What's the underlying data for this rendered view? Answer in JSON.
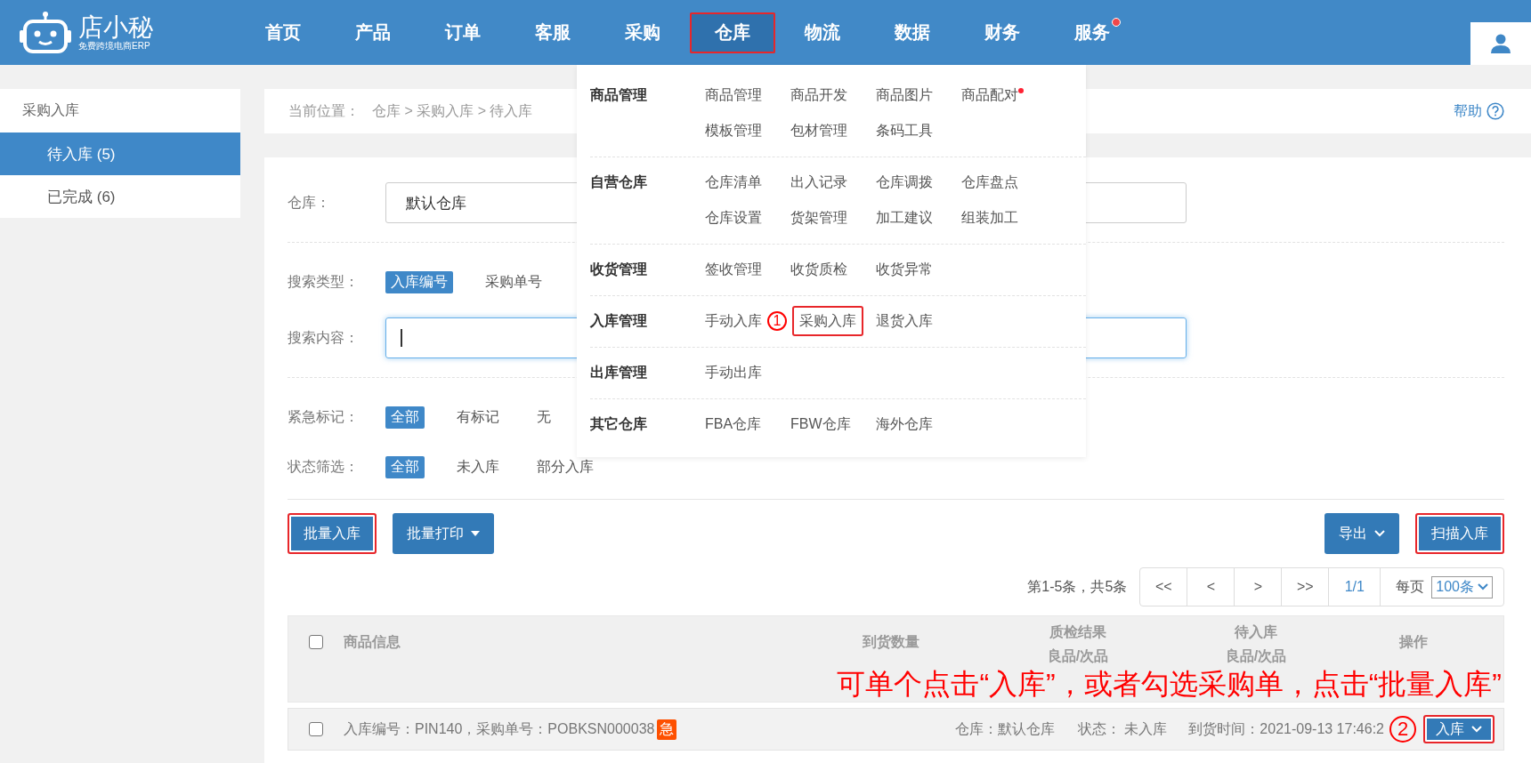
{
  "logo": {
    "name": "店小秘",
    "tagline": "免费跨境电商ERP"
  },
  "nav": [
    {
      "label": "首页",
      "selected": false,
      "dot": false,
      "annotated": false
    },
    {
      "label": "产品",
      "selected": false,
      "dot": false,
      "annotated": false
    },
    {
      "label": "订单",
      "selected": false,
      "dot": false,
      "annotated": false
    },
    {
      "label": "客服",
      "selected": false,
      "dot": false,
      "annotated": false
    },
    {
      "label": "采购",
      "selected": false,
      "dot": false,
      "annotated": false
    },
    {
      "label": "仓库",
      "selected": true,
      "dot": false,
      "annotated": true
    },
    {
      "label": "物流",
      "selected": false,
      "dot": false,
      "annotated": false
    },
    {
      "label": "数据",
      "selected": false,
      "dot": false,
      "annotated": false
    },
    {
      "label": "财务",
      "selected": false,
      "dot": false,
      "annotated": false
    },
    {
      "label": "服务",
      "selected": false,
      "dot": true,
      "annotated": false
    }
  ],
  "sidebar": {
    "title": "采购入库",
    "items": [
      {
        "label": "待入库 (5)",
        "selected": true
      },
      {
        "label": "已完成 (6)",
        "selected": false
      }
    ]
  },
  "breadcrumb": {
    "label": "当前位置：",
    "path": "仓库 > 采购入库 > 待入库",
    "help": "帮助"
  },
  "filter_groups": [
    [
      {
        "kind": "select",
        "label": "仓库：",
        "value": "默认仓库"
      }
    ],
    [
      {
        "kind": "options",
        "label": "搜索类型：",
        "options": [
          {
            "label": "入库编号",
            "selected": true
          },
          {
            "label": "采购单号",
            "selected": false
          }
        ]
      },
      {
        "kind": "input",
        "label": "搜索内容：",
        "focused": true
      }
    ],
    [
      {
        "kind": "options",
        "label": "紧急标记：",
        "options": [
          {
            "label": "全部",
            "selected": true
          },
          {
            "label": "有标记",
            "selected": false
          },
          {
            "label": "无",
            "selected": false
          }
        ]
      },
      {
        "kind": "options",
        "label": "状态筛选：",
        "options": [
          {
            "label": "全部",
            "selected": true
          },
          {
            "label": "未入库",
            "selected": false
          },
          {
            "label": "部分入库",
            "selected": false
          }
        ]
      }
    ]
  ],
  "toolbar": {
    "left": [
      {
        "label": "批量入库",
        "kind": "plain",
        "annotated": true
      },
      {
        "label": "批量打印",
        "kind": "dropdown",
        "annotated": false
      }
    ],
    "right": [
      {
        "label": "导出",
        "kind": "menu",
        "annotated": false
      },
      {
        "label": "扫描入库",
        "kind": "plain",
        "annotated": true
      }
    ]
  },
  "pagination": {
    "summary": "第1-5条，共5条",
    "buttons": [
      "<<",
      "<",
      ">",
      ">>"
    ],
    "page": "1/1",
    "per_page_label": "每页",
    "per_page": "100条"
  },
  "table": {
    "all_checked": false,
    "columns": [
      {
        "label": "商品信息"
      },
      {
        "label": "到货数量"
      },
      {
        "label": "质检结果",
        "sub": "良品/次品"
      },
      {
        "label": "待入库",
        "sub": "良品/次品"
      },
      {
        "label": "操作"
      }
    ],
    "rows": [
      {
        "checked": false,
        "info": "入库编号：PIN140，采购单号：POBKSN000038",
        "badge": "急",
        "warehouse": "仓库：默认仓库",
        "status": "状态： 未入库",
        "arrival": "到货时间：2021-09-13 17:46:2",
        "marker": "2",
        "action": "入库",
        "annotated": true
      }
    ]
  },
  "menu": {
    "sections": [
      {
        "title": "商品管理",
        "items": [
          {
            "label": "商品管理",
            "dot": false,
            "annotated": false
          },
          {
            "label": "商品开发",
            "dot": false,
            "annotated": false
          },
          {
            "label": "商品图片",
            "dot": false,
            "annotated": false
          },
          {
            "label": "商品配对",
            "dot": true,
            "annotated": false
          },
          {
            "label": "模板管理",
            "dot": false,
            "annotated": false
          },
          {
            "label": "包材管理",
            "dot": false,
            "annotated": false
          },
          {
            "label": "条码工具",
            "dot": false,
            "annotated": false
          }
        ]
      },
      {
        "title": "自营仓库",
        "items": [
          {
            "label": "仓库清单",
            "dot": false,
            "annotated": false
          },
          {
            "label": "出入记录",
            "dot": false,
            "annotated": false
          },
          {
            "label": "仓库调拨",
            "dot": false,
            "annotated": false
          },
          {
            "label": "仓库盘点",
            "dot": false,
            "annotated": false
          },
          {
            "label": "仓库设置",
            "dot": false,
            "annotated": false
          },
          {
            "label": "货架管理",
            "dot": false,
            "annotated": false
          },
          {
            "label": "加工建议",
            "dot": false,
            "annotated": false
          },
          {
            "label": "组装加工",
            "dot": false,
            "annotated": false
          }
        ]
      },
      {
        "title": "收货管理",
        "items": [
          {
            "label": "签收管理",
            "dot": false,
            "annotated": false
          },
          {
            "label": "收货质检",
            "dot": false,
            "annotated": false
          },
          {
            "label": "收货异常",
            "dot": false,
            "annotated": false
          }
        ]
      },
      {
        "title": "入库管理",
        "items": [
          {
            "label": "手动入库",
            "dot": false,
            "annotated": false
          },
          {
            "label": "采购入库",
            "dot": false,
            "annotated": true,
            "marker": "1"
          },
          {
            "label": "退货入库",
            "dot": false,
            "annotated": false
          }
        ]
      },
      {
        "title": "出库管理",
        "items": [
          {
            "label": "手动出库",
            "dot": false,
            "annotated": false
          }
        ]
      },
      {
        "title": "其它仓库",
        "items": [
          {
            "label": "FBA仓库",
            "dot": false,
            "annotated": false
          },
          {
            "label": "FBW仓库",
            "dot": false,
            "annotated": false
          },
          {
            "label": "海外仓库",
            "dot": false,
            "annotated": false
          }
        ]
      }
    ]
  },
  "note": "可单个点击“入库”，或者勾选采购单，点击“批量入库”"
}
